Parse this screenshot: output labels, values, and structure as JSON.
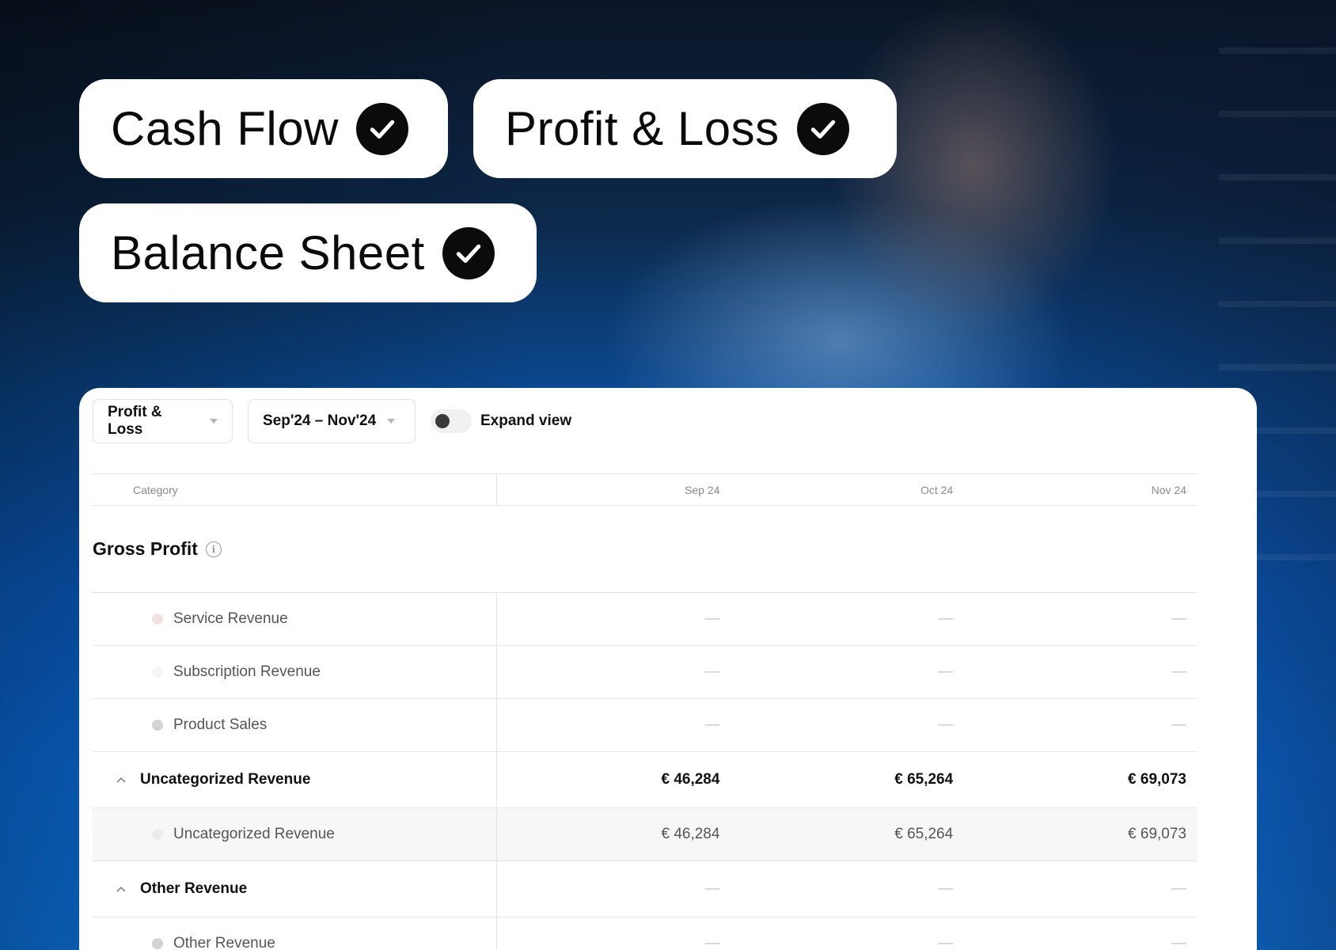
{
  "badges": [
    {
      "label": "Cash Flow"
    },
    {
      "label": "Profit & Loss"
    },
    {
      "label": "Balance Sheet"
    }
  ],
  "toolbar": {
    "report_select": "Profit & Loss",
    "period_select": "Sep'24 – Nov'24",
    "expand_label": "Expand view"
  },
  "table": {
    "columns": [
      "Category",
      "Sep 24",
      "Oct 24",
      "Nov 24"
    ],
    "section_title": "Gross Profit",
    "rows": [
      {
        "label": "Service Revenue",
        "values": [
          "—",
          "—",
          "—"
        ],
        "dot_color": "#efe3e3"
      },
      {
        "label": "Subscription Revenue",
        "values": [
          "—",
          "—",
          "—"
        ],
        "dot_color": "#f6f6f6"
      },
      {
        "label": "Product Sales",
        "values": [
          "—",
          "—",
          "—"
        ],
        "dot_color": "#d4d4d4"
      },
      {
        "label": "Uncategorized Revenue",
        "values": [
          "€ 46,284",
          "€ 65,264",
          "€ 69,073"
        ]
      },
      {
        "label": "Uncategorized Revenue",
        "values": [
          "€ 46,284",
          "€ 65,264",
          "€ 69,073"
        ],
        "dot_color": "#ececec"
      },
      {
        "label": "Other Revenue",
        "values": [
          "—",
          "—",
          "—"
        ]
      },
      {
        "label": "Other Revenue",
        "values": [
          "—",
          "—",
          "—"
        ],
        "dot_color": "#d4d4d4"
      }
    ]
  },
  "icons": {
    "badge_check": "check-circle-icon",
    "dropdown_caret": "caret-down-icon",
    "info": "info-icon",
    "collapse": "chevron-up-icon",
    "category_dot": "dot-icon"
  }
}
